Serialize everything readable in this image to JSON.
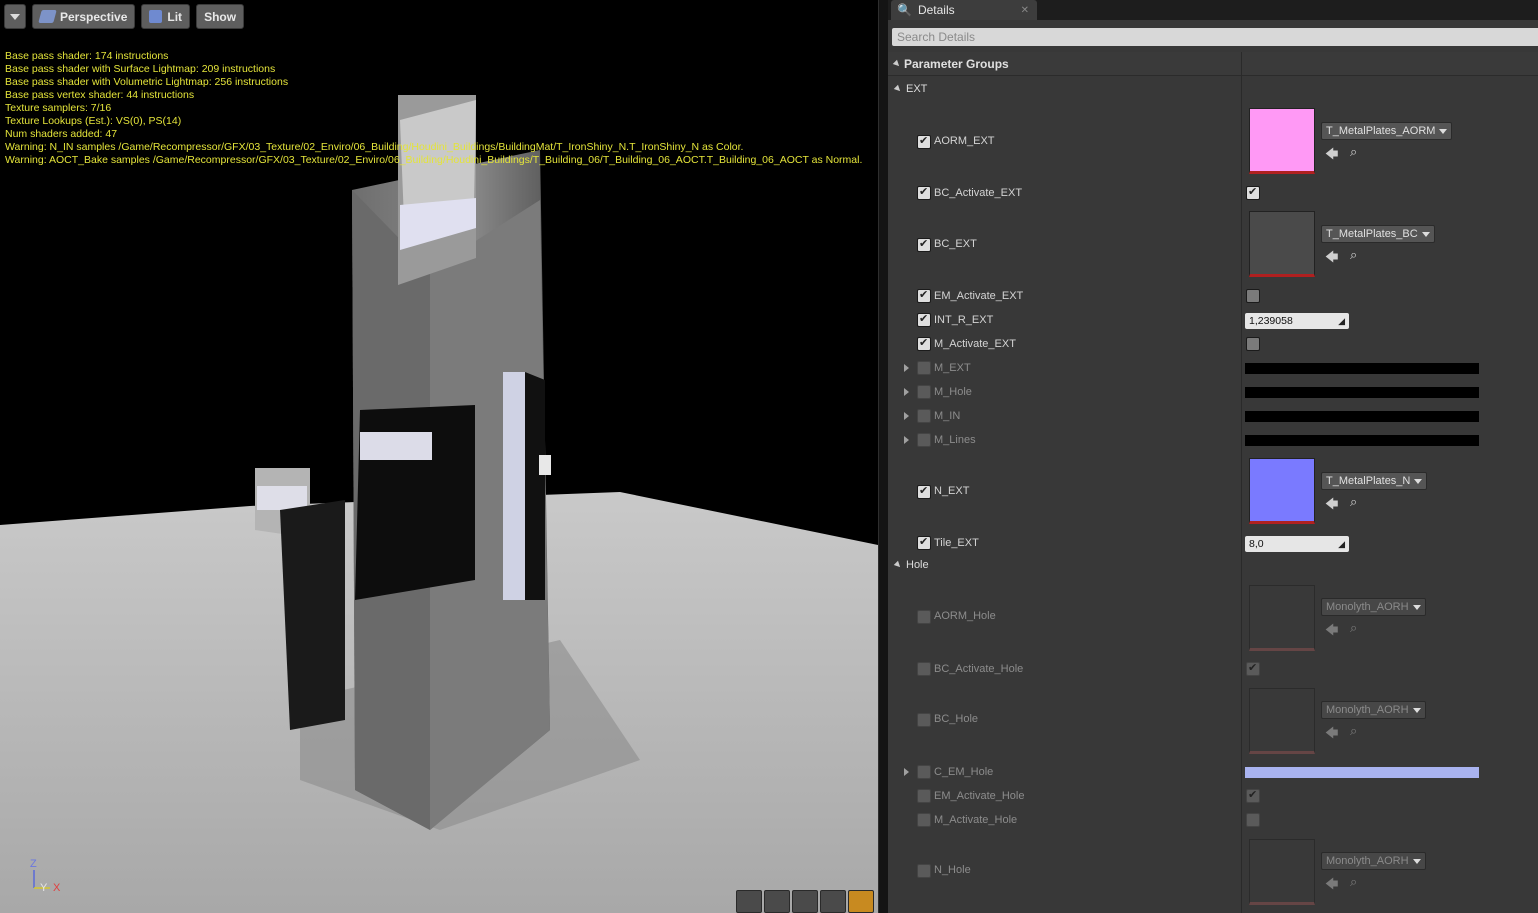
{
  "viewport": {
    "toolbar": {
      "perspective_label": "Perspective",
      "lit_label": "Lit",
      "show_label": "Show"
    },
    "stats": [
      "Base pass shader: 174 instructions",
      "Base pass shader with Surface Lightmap: 209 instructions",
      "Base pass shader with Volumetric Lightmap: 256 instructions",
      "Base pass vertex shader: 44 instructions",
      "Texture samplers: 7/16",
      "Texture Lookups (Est.): VS(0), PS(14)",
      "Num shaders added: 47",
      "Warning: N_IN samples /Game/Recompressor/GFX/03_Texture/02_Enviro/06_Building/Houdini_Buildings/BuildingMat/T_IronShiny_N.T_IronShiny_N as Color.",
      "Warning: AOCT_Bake samples /Game/Recompressor/GFX/03_Texture/02_Enviro/06_Building/Houdini_Buildings/T_Building_06/T_Building_06_AOCT.T_Building_06_AOCT as Normal."
    ],
    "axis": {
      "z": "Z",
      "y": "Y",
      "x": "X"
    }
  },
  "details": {
    "tab_label": "Details",
    "search_placeholder": "Search Details",
    "parameter_groups_label": "Parameter Groups",
    "groups": {
      "ext": "EXT",
      "hole": "Hole"
    },
    "params": {
      "aorm_ext": {
        "label": "AORM_EXT",
        "asset": "T_MetalPlates_AORM",
        "color": "#ff99f5"
      },
      "bc_activate_ext": {
        "label": "BC_Activate_EXT"
      },
      "bc_ext": {
        "label": "BC_EXT",
        "asset": "T_MetalPlates_BC"
      },
      "em_activate_ext": {
        "label": "EM_Activate_EXT"
      },
      "int_r_ext": {
        "label": "INT_R_EXT",
        "value": "1,239058"
      },
      "m_activate_ext": {
        "label": "M_Activate_EXT"
      },
      "m_ext": {
        "label": "M_EXT"
      },
      "m_hole": {
        "label": "M_Hole"
      },
      "m_in": {
        "label": "M_IN"
      },
      "m_lines": {
        "label": "M_Lines"
      },
      "n_ext": {
        "label": "N_EXT",
        "asset": "T_MetalPlates_N",
        "color": "#7a7aff"
      },
      "tile_ext": {
        "label": "Tile_EXT",
        "value": "8,0"
      },
      "aorm_hole": {
        "label": "AORM_Hole",
        "asset": "Monolyth_AORH"
      },
      "bc_activate_hole": {
        "label": "BC_Activate_Hole"
      },
      "bc_hole": {
        "label": "BC_Hole",
        "asset": "Monolyth_AORH"
      },
      "c_em_hole": {
        "label": "C_EM_Hole",
        "color": "#a9b3f0"
      },
      "em_activate_hole": {
        "label": "EM_Activate_Hole"
      },
      "m_activate_hole": {
        "label": "M_Activate_Hole"
      },
      "n_hole": {
        "label": "N_Hole",
        "asset": "Monolyth_AORH"
      }
    }
  }
}
